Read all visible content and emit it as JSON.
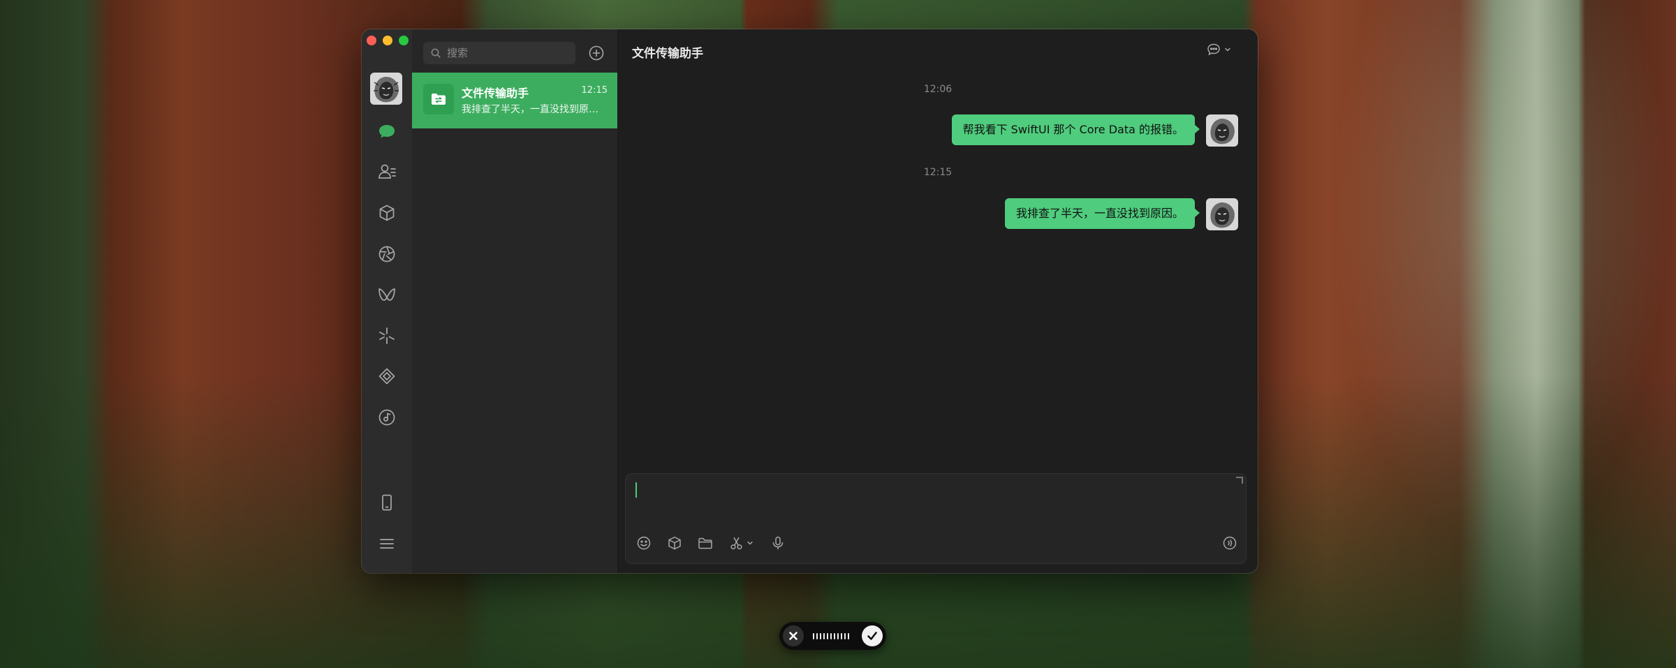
{
  "window": {
    "traffic_lights": {
      "close": "#fe5f57",
      "minimize": "#febc2e",
      "maximize": "#28c840"
    }
  },
  "sidebar": {
    "user_avatar": "lion-avatar",
    "items": [
      {
        "id": "chats",
        "icon": "chat-bubble-icon",
        "active": true,
        "accent": "#3cad5f"
      },
      {
        "id": "contacts",
        "icon": "contacts-icon"
      },
      {
        "id": "favorites",
        "icon": "cube-icon"
      },
      {
        "id": "moments",
        "icon": "aperture-icon"
      },
      {
        "id": "channels",
        "icon": "butterfly-icon"
      },
      {
        "id": "miniprograms",
        "icon": "sparkle-icon"
      },
      {
        "id": "search",
        "icon": "diamond-icon"
      },
      {
        "id": "music",
        "icon": "music-disc-icon"
      }
    ],
    "bottom_items": [
      {
        "id": "phone",
        "icon": "phone-icon"
      },
      {
        "id": "settings",
        "icon": "menu-icon"
      }
    ]
  },
  "chat_list": {
    "search_placeholder": "搜索",
    "chats": [
      {
        "name": "文件传输助手",
        "time": "12:15",
        "preview": "我排查了半天，一直没找到原因。",
        "selected": true,
        "icon": "folder-transfer-icon"
      }
    ]
  },
  "conversation": {
    "title": "文件传输助手",
    "messages": [
      {
        "timestamp": "12:06",
        "text": "帮我看下 SwiftUI 那个 Core Data 的报错。",
        "from": "self"
      },
      {
        "timestamp": "12:15",
        "text": "我排查了半天，一直没找到原因。",
        "from": "self"
      }
    ],
    "bubble_color": "#4fcc7d"
  },
  "composer": {
    "value": "",
    "tools": [
      "emoji-icon",
      "cube-icon",
      "folder-icon",
      "scissors-icon",
      "microphone-icon"
    ],
    "right_tool": "voice-call-icon"
  },
  "dictation": {
    "cancel": "close-icon",
    "confirm": "checkmark-icon"
  }
}
